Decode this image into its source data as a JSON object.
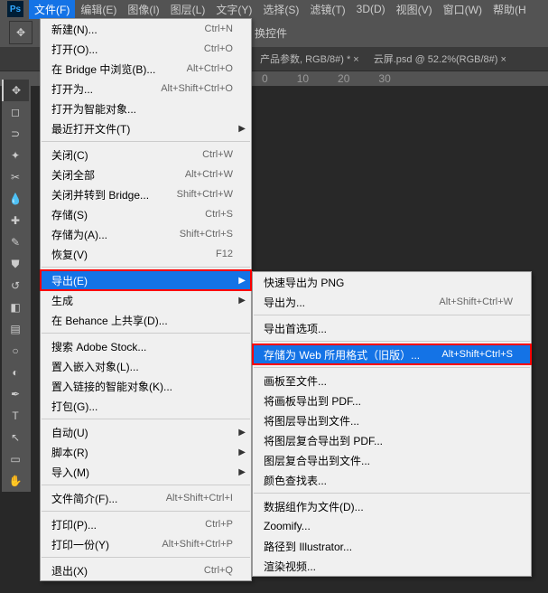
{
  "menubar": {
    "items": [
      {
        "label": "文件(F)",
        "active": true
      },
      {
        "label": "编辑(E)"
      },
      {
        "label": "图像(I)"
      },
      {
        "label": "图层(L)"
      },
      {
        "label": "文字(Y)"
      },
      {
        "label": "选择(S)"
      },
      {
        "label": "滤镜(T)"
      },
      {
        "label": "3D(D)"
      },
      {
        "label": "视图(V)"
      },
      {
        "label": "窗口(W)"
      },
      {
        "label": "帮助(H"
      }
    ]
  },
  "toolbar": {
    "label": "换控件"
  },
  "tabs": [
    {
      "label": "产品参数, RGB/8#) * ×"
    },
    {
      "label": "云屏.psd @ 52.2%(RGB/8#) ×"
    }
  ],
  "ruler": [
    "0",
    "10",
    "20",
    "30"
  ],
  "file_menu": [
    {
      "label": "新建(N)...",
      "shortcut": "Ctrl+N"
    },
    {
      "label": "打开(O)...",
      "shortcut": "Ctrl+O"
    },
    {
      "label": "在 Bridge 中浏览(B)...",
      "shortcut": "Alt+Ctrl+O"
    },
    {
      "label": "打开为...",
      "shortcut": "Alt+Shift+Ctrl+O"
    },
    {
      "label": "打开为智能对象..."
    },
    {
      "label": "最近打开文件(T)",
      "submenu": true
    },
    {
      "sep": true
    },
    {
      "label": "关闭(C)",
      "shortcut": "Ctrl+W"
    },
    {
      "label": "关闭全部",
      "shortcut": "Alt+Ctrl+W"
    },
    {
      "label": "关闭并转到 Bridge...",
      "shortcut": "Shift+Ctrl+W"
    },
    {
      "label": "存储(S)",
      "shortcut": "Ctrl+S"
    },
    {
      "label": "存储为(A)...",
      "shortcut": "Shift+Ctrl+S"
    },
    {
      "label": "恢复(V)",
      "shortcut": "F12"
    },
    {
      "sep": true
    },
    {
      "label": "导出(E)",
      "submenu": true,
      "highlighted": true,
      "redbox": true
    },
    {
      "label": "生成",
      "submenu": true
    },
    {
      "label": "在 Behance 上共享(D)..."
    },
    {
      "sep": true
    },
    {
      "label": "搜索 Adobe Stock..."
    },
    {
      "label": "置入嵌入对象(L)..."
    },
    {
      "label": "置入链接的智能对象(K)..."
    },
    {
      "label": "打包(G)..."
    },
    {
      "sep": true
    },
    {
      "label": "自动(U)",
      "submenu": true
    },
    {
      "label": "脚本(R)",
      "submenu": true
    },
    {
      "label": "导入(M)",
      "submenu": true
    },
    {
      "sep": true
    },
    {
      "label": "文件简介(F)...",
      "shortcut": "Alt+Shift+Ctrl+I"
    },
    {
      "sep": true
    },
    {
      "label": "打印(P)...",
      "shortcut": "Ctrl+P"
    },
    {
      "label": "打印一份(Y)",
      "shortcut": "Alt+Shift+Ctrl+P"
    },
    {
      "sep": true
    },
    {
      "label": "退出(X)",
      "shortcut": "Ctrl+Q"
    }
  ],
  "export_menu": [
    {
      "label": "快速导出为 PNG"
    },
    {
      "label": "导出为...",
      "shortcut": "Alt+Shift+Ctrl+W"
    },
    {
      "sep": true
    },
    {
      "label": "导出首选项..."
    },
    {
      "sep": true
    },
    {
      "label": "存储为 Web 所用格式（旧版）...",
      "shortcut": "Alt+Shift+Ctrl+S",
      "highlighted": true,
      "redbox": true
    },
    {
      "sep": true
    },
    {
      "label": "画板至文件..."
    },
    {
      "label": "将画板导出到 PDF..."
    },
    {
      "label": "将图层导出到文件..."
    },
    {
      "label": "将图层复合导出到 PDF..."
    },
    {
      "label": "图层复合导出到文件..."
    },
    {
      "label": "颜色查找表..."
    },
    {
      "sep": true
    },
    {
      "label": "数据组作为文件(D)..."
    },
    {
      "label": "Zoomify..."
    },
    {
      "label": "路径到 Illustrator..."
    },
    {
      "label": "渲染视频..."
    }
  ]
}
